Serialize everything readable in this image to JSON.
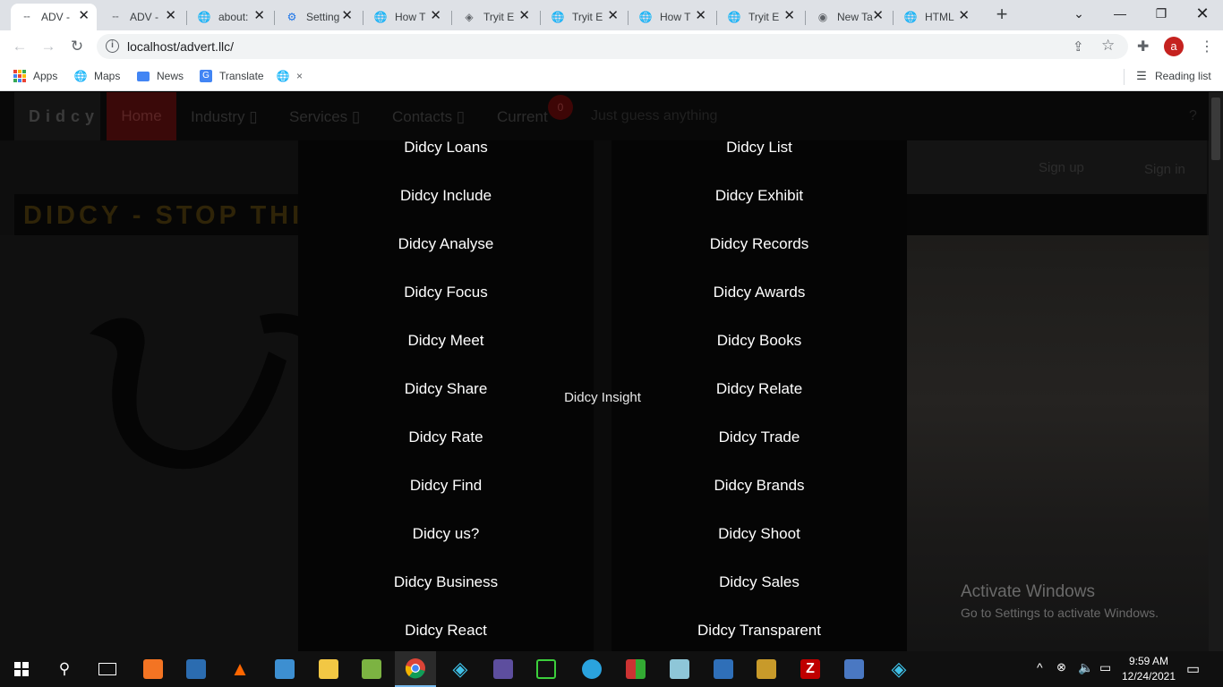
{
  "browser": {
    "tabs": [
      {
        "title": "ADV -",
        "icon": "dash-favicon",
        "active": true
      },
      {
        "title": "ADV -",
        "icon": "dash-favicon",
        "active": false
      },
      {
        "title": "about:",
        "icon": "globe-icon",
        "active": false
      },
      {
        "title": "Setting",
        "icon": "gear-icon",
        "active": false
      },
      {
        "title": "How T",
        "icon": "globe-icon",
        "active": false
      },
      {
        "title": "Tryit E",
        "icon": "tryit-icon",
        "active": false
      },
      {
        "title": "Tryit E",
        "icon": "globe-icon",
        "active": false
      },
      {
        "title": "How T",
        "icon": "globe-icon",
        "active": false
      },
      {
        "title": "Tryit E",
        "icon": "globe-icon",
        "active": false
      },
      {
        "title": "New Ta",
        "icon": "chrome-icon",
        "active": false
      },
      {
        "title": "HTML",
        "icon": "globe-icon",
        "active": false
      }
    ],
    "url": "localhost/advert.llc/",
    "profile_initial": "a",
    "bookmarks": [
      {
        "label": "Apps",
        "icon": "apps-grid-icon"
      },
      {
        "label": "Maps",
        "icon": "globe-icon"
      },
      {
        "label": "News",
        "icon": "news-icon"
      },
      {
        "label": "Translate",
        "icon": "translate-icon"
      },
      {
        "label": "×",
        "icon": "globe-icon"
      }
    ],
    "reading_list": "Reading list"
  },
  "site": {
    "brand": "Didcy",
    "nav": {
      "home": "Home",
      "industry": "Industry ▯",
      "services": "Services ▯",
      "contacts": "Contacts ▯",
      "current": "Current",
      "badge": "0",
      "search_placeholder": "Just guess anything",
      "help": "?"
    },
    "auth": {
      "signup": "Sign up",
      "signin": "Sign in"
    },
    "banner": "DIDCY - STOP THINKING TOO MUCH & JUST DO IT",
    "mega_menu": {
      "left": [
        "Didcy Loans",
        "Didcy Include",
        "Didcy Analyse",
        "Didcy Focus",
        "Didcy Meet",
        "Didcy Share",
        "Didcy Rate",
        "Didcy Find",
        "Didcy us?",
        "Didcy Business",
        "Didcy React"
      ],
      "middle": "Didcy Insight",
      "right": [
        "Didcy List",
        "Didcy Exhibit",
        "Didcy Records",
        "Didcy Awards",
        "Didcy Books",
        "Didcy Relate",
        "Didcy Trade",
        "Didcy Brands",
        "Didcy Shoot",
        "Didcy Sales",
        "Didcy Transparent"
      ]
    }
  },
  "watermark": {
    "title": "Activate Windows",
    "subtitle": "Go to Settings to activate Windows."
  },
  "taskbar": {
    "time": "9:59 AM",
    "date": "12/24/2021"
  }
}
